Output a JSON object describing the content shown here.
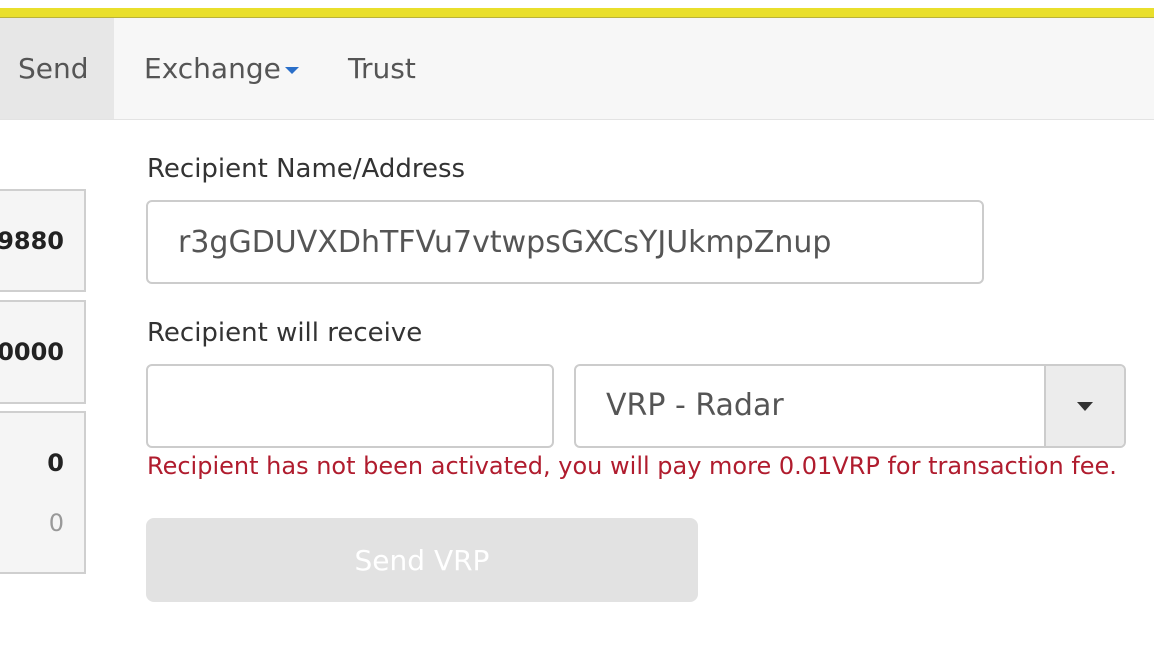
{
  "nav": {
    "send": "Send",
    "exchange": "Exchange",
    "trust": "Trust"
  },
  "balances": [
    {
      "value": "9880"
    },
    {
      "value": "0000"
    },
    {
      "value": "0",
      "sub": "0"
    }
  ],
  "form": {
    "recipient_label": "Recipient Name/Address",
    "recipient_value": "r3gGDUVXDhTFVu7vtwpsGXCsYJUkmpZnup",
    "receive_label": "Recipient will receive",
    "amount_value": "",
    "currency_selected": "VRP - Radar",
    "error": "Recipient has not been activated, you will pay more 0.01VRP for transaction fee.",
    "submit_label": "Send VRP"
  },
  "colors": {
    "top_stripe": "#e9df2c",
    "error_text": "#b01c2e",
    "dropdown_caret": "#2a6fc9",
    "disabled_button": "#e2e2e2"
  }
}
